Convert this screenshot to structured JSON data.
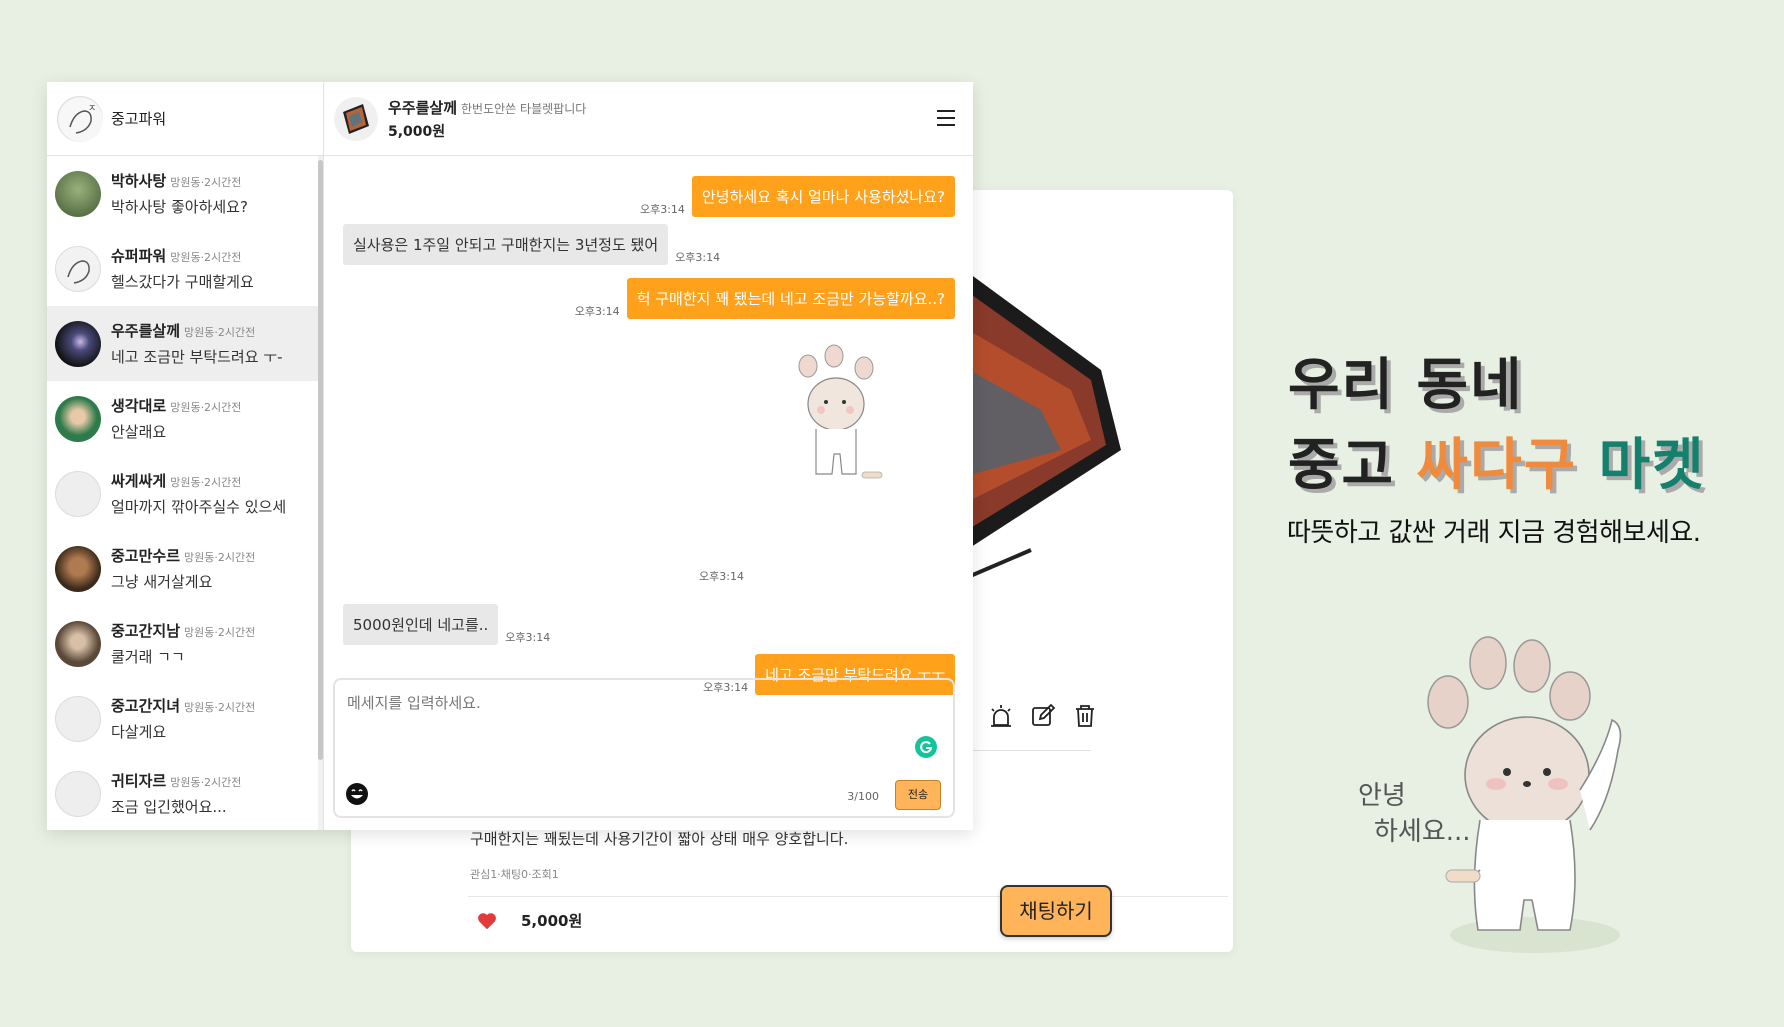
{
  "sidebar": {
    "header_name": "중고파워",
    "items": [
      {
        "name": "박하사탕",
        "meta": "망원동·2시간전",
        "message": "박하사탕 좋아하세요?"
      },
      {
        "name": "슈퍼파워",
        "meta": "망원동·2시간전",
        "message": "헬스갔다가 구매할게요"
      },
      {
        "name": "우주를살께",
        "meta": "망원동·2시간전",
        "message": "네고 조금만 부탁드려요 ㅜ-"
      },
      {
        "name": "생각대로",
        "meta": "망원동·2시간전",
        "message": "안살래요"
      },
      {
        "name": "싸게싸게",
        "meta": "망원동·2시간전",
        "message": "얼마까지 깎아주실수 있으세"
      },
      {
        "name": "중고만수르",
        "meta": "망원동·2시간전",
        "message": "그냥 새거살게요"
      },
      {
        "name": "중고간지남",
        "meta": "망원동·2시간전",
        "message": "쿨거래 ㄱㄱ"
      },
      {
        "name": "중고간지녀",
        "meta": "망원동·2시간전",
        "message": "다살게요"
      },
      {
        "name": "귀티자르",
        "meta": "망원동·2시간전",
        "message": "조금 입긴했어요..."
      }
    ]
  },
  "chat": {
    "partner_name": "우주를살께",
    "product_title": "한번도안쓴 타블렛팝니다",
    "price": "5,000원",
    "messages": [
      {
        "from": "me",
        "text": "안녕하세요 혹시 얼마나 사용하셨나요?",
        "time": "오후3:14"
      },
      {
        "from": "other",
        "text": "실사용은 1주일 안되고 구매한지는 3년정도 됐어",
        "time": "오후3:14"
      },
      {
        "from": "me",
        "text": "헉 구매한지 꽤 됐는데 네고 조금만 가능할까요..?",
        "time": "오후3:14"
      },
      {
        "from": "me",
        "sticker": "paw-bunny-sticker",
        "time": "오후3:14"
      },
      {
        "from": "other",
        "text": "5000원인데 네고를..",
        "time": "오후3:14"
      },
      {
        "from": "me",
        "text": "네고 조금만 부탁드려요 ㅜㅜ",
        "time": "오후3:14"
      }
    ],
    "input": {
      "placeholder": "메세지를 입력하세요.",
      "counter": "3/100",
      "send_label": "전송"
    }
  },
  "product_card": {
    "description": "구매한지는 꽤됬는데 사용기간이 짧아 상태 매우 양호합니다.",
    "stats": "관심1·채팅0·조회1",
    "price": "5,000원",
    "chat_button": "채팅하기"
  },
  "hero": {
    "line1": "우리 동네",
    "line2_a": "중고 ",
    "line2_b": "싸다구",
    "line2_c": " 마켓",
    "subtitle": "따뜻하고 값싼 거래 지금 경험해보세요.",
    "hello_1": "안녕",
    "hello_2": "하세요..."
  },
  "colors": {
    "accent": "#ffa11a",
    "button": "#ffb45a",
    "teal": "#14806d",
    "orange": "#f08a3c",
    "background": "#e8f0e3"
  }
}
